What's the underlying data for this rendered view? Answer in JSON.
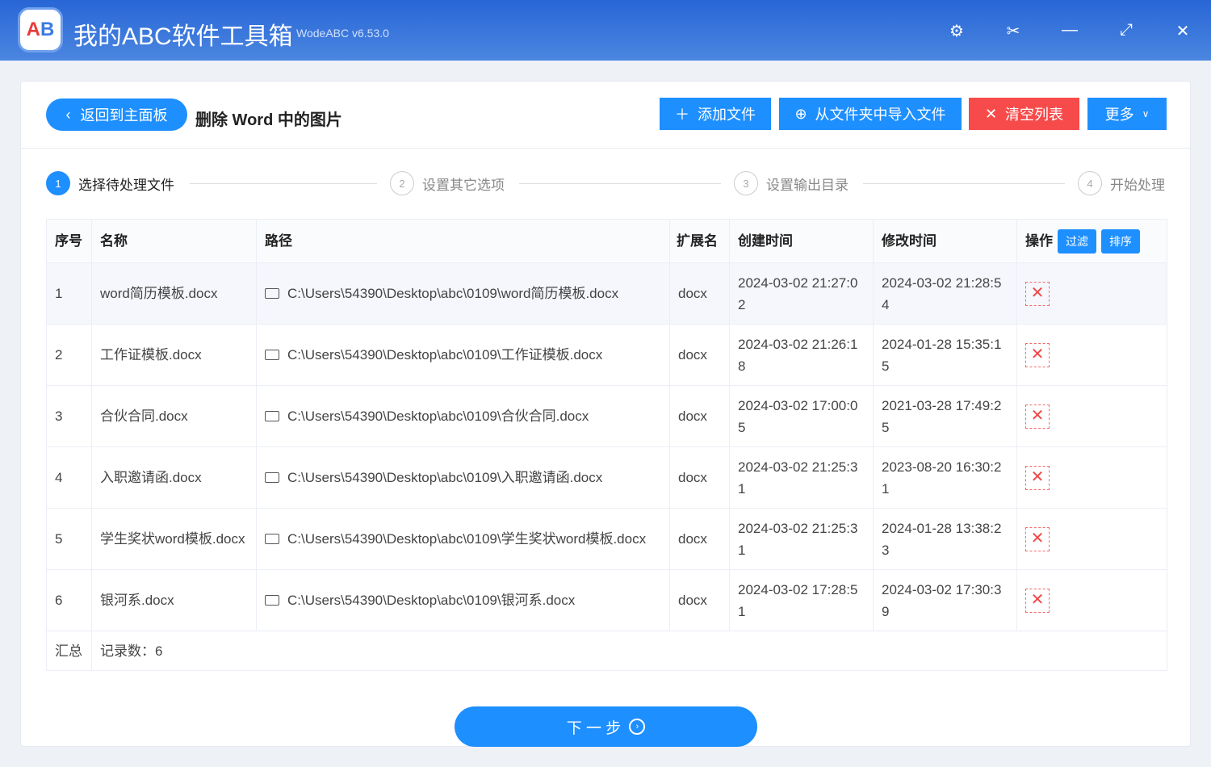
{
  "app": {
    "title": "我的ABC软件工具箱",
    "version": "WodeABC v6.53.0",
    "logo": "AB"
  },
  "header": {
    "back": "返回到主面板",
    "page_title": "删除 Word 中的图片",
    "add": "添加文件",
    "import": "从文件夹中导入文件",
    "clear": "清空列表",
    "more": "更多"
  },
  "steps": [
    {
      "n": "1",
      "label": "选择待处理文件"
    },
    {
      "n": "2",
      "label": "设置其它选项"
    },
    {
      "n": "3",
      "label": "设置输出目录"
    },
    {
      "n": "4",
      "label": "开始处理"
    }
  ],
  "table": {
    "headers": [
      "序号",
      "名称",
      "路径",
      "扩展名",
      "创建时间",
      "修改时间",
      "操作"
    ],
    "filter": "过滤",
    "sort": "排序",
    "rows": [
      {
        "n": "1",
        "name": "word简历模板.docx",
        "path": "C:\\Users\\54390\\Desktop\\abc\\0109\\word简历模板.docx",
        "ext": "docx",
        "created": "2024-03-02 21:27:02",
        "modified": "2024-03-02 21:28:54"
      },
      {
        "n": "2",
        "name": "工作证模板.docx",
        "path": "C:\\Users\\54390\\Desktop\\abc\\0109\\工作证模板.docx",
        "ext": "docx",
        "created": "2024-03-02 21:26:18",
        "modified": "2024-01-28 15:35:15"
      },
      {
        "n": "3",
        "name": "合伙合同.docx",
        "path": "C:\\Users\\54390\\Desktop\\abc\\0109\\合伙合同.docx",
        "ext": "docx",
        "created": "2024-03-02 17:00:05",
        "modified": "2021-03-28 17:49:25"
      },
      {
        "n": "4",
        "name": "入职邀请函.docx",
        "path": "C:\\Users\\54390\\Desktop\\abc\\0109\\入职邀请函.docx",
        "ext": "docx",
        "created": "2024-03-02 21:25:31",
        "modified": "2023-08-20 16:30:21"
      },
      {
        "n": "5",
        "name": "学生奖状word模板.docx",
        "path": "C:\\Users\\54390\\Desktop\\abc\\0109\\学生奖状word模板.docx",
        "ext": "docx",
        "created": "2024-03-02 21:25:31",
        "modified": "2024-01-28 13:38:23"
      },
      {
        "n": "6",
        "name": "银河系.docx",
        "path": "C:\\Users\\54390\\Desktop\\abc\\0109\\银河系.docx",
        "ext": "docx",
        "created": "2024-03-02 17:28:51",
        "modified": "2024-03-02 17:30:39"
      }
    ],
    "summary_label": "汇总",
    "summary_count": "记录数：6"
  },
  "footer": {
    "next": "下 一 步"
  }
}
